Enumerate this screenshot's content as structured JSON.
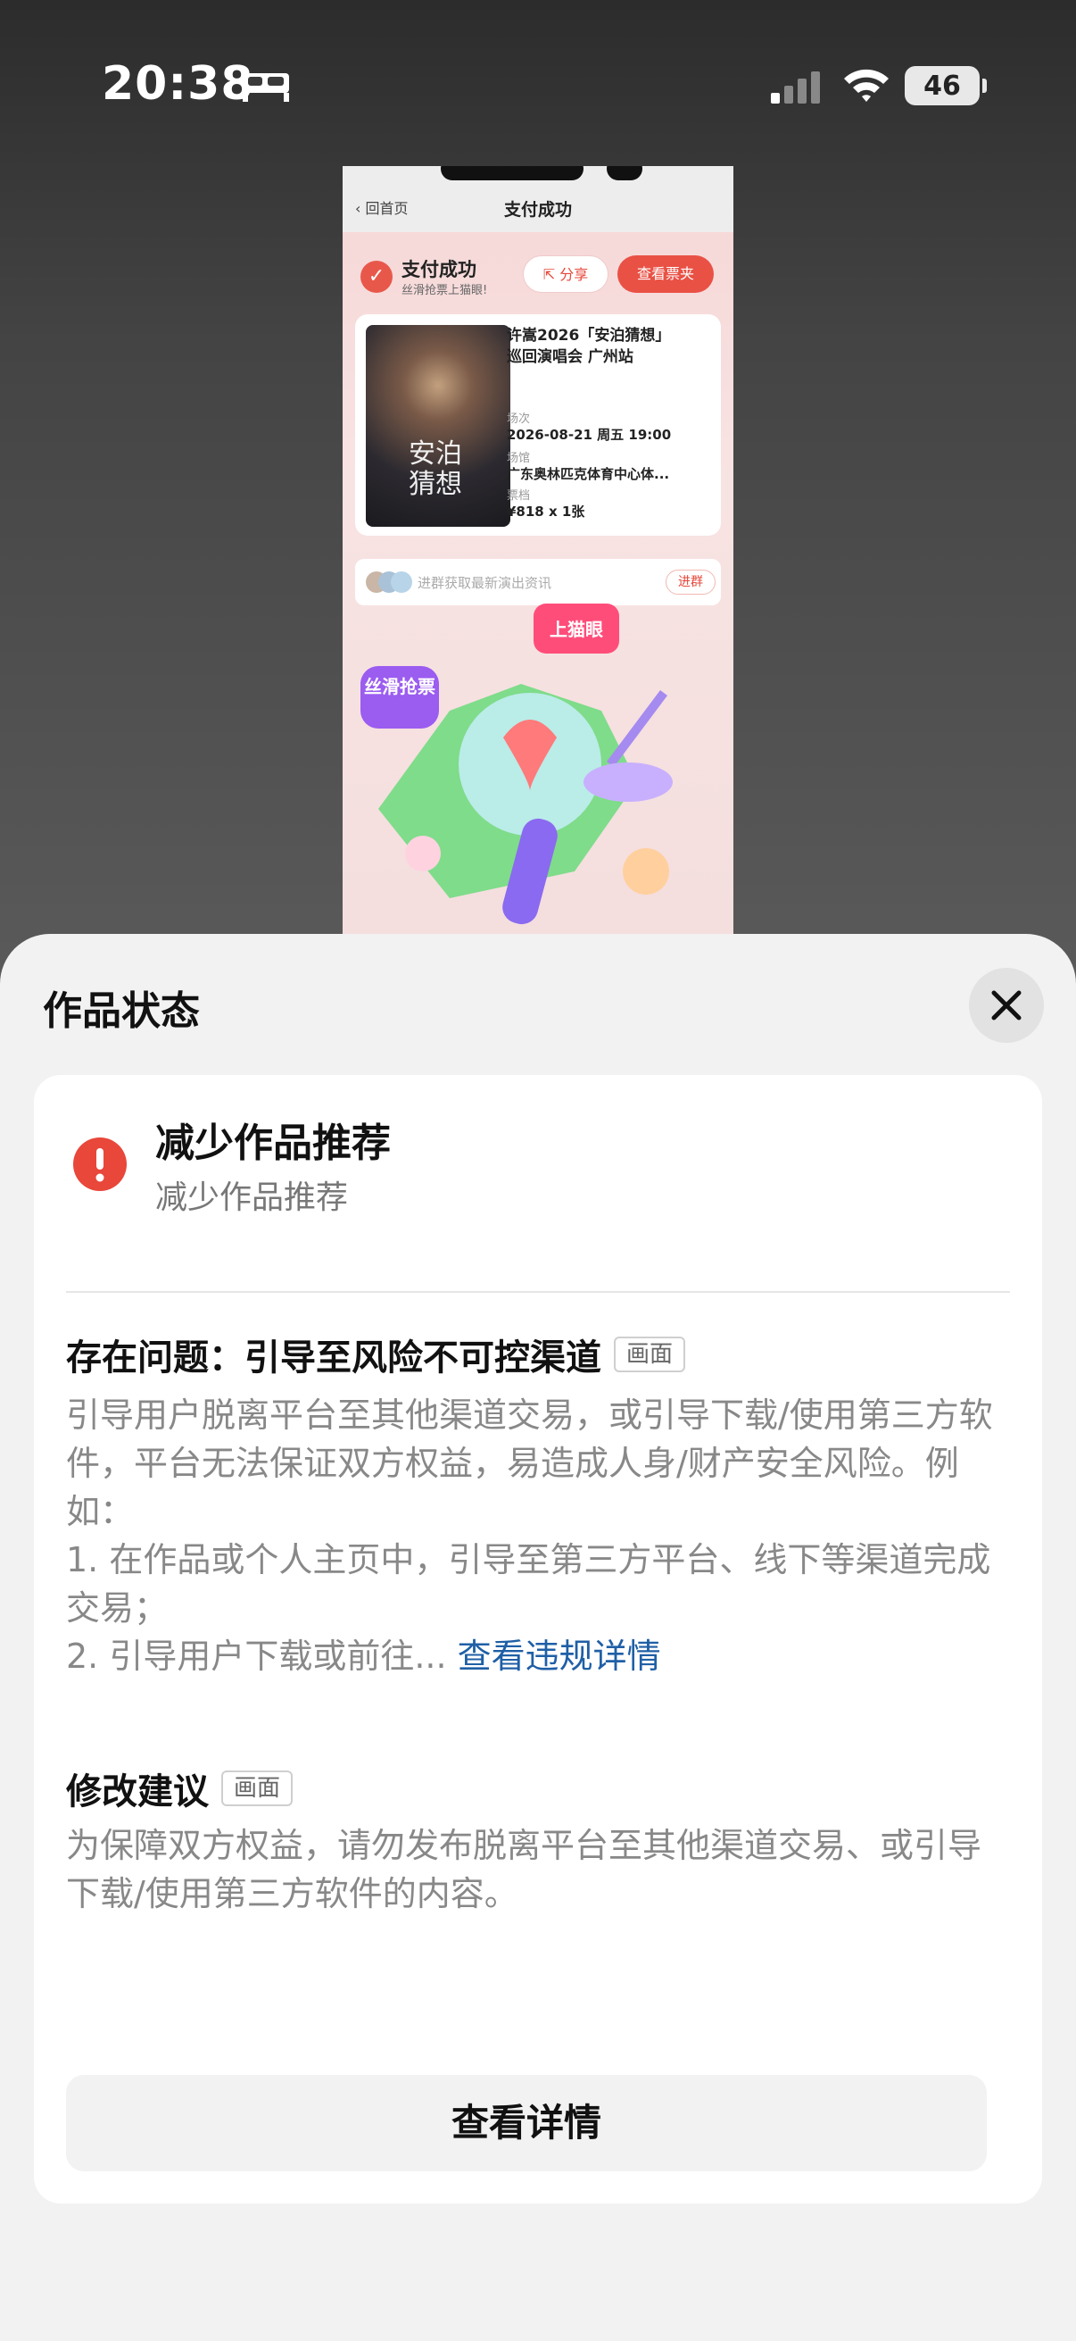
{
  "status_bar": {
    "time": "20:38",
    "battery": "46"
  },
  "preview": {
    "back_label": "回首页",
    "title": "支付成功",
    "success_title": "支付成功",
    "success_sub": "丝滑抢票上猫眼!",
    "share_label": "分享",
    "ticket_label": "查看票夹",
    "poster_text_line1": "安泊",
    "poster_text_line2": "猜想",
    "event_title": "许嵩2026「安泊猜想」巡回演唱会 广州站",
    "session_label": "场次",
    "session_value": "2026-08-21 周五 19:00",
    "venue_label": "场馆",
    "venue_value": "广东奥林匹克体育中心体...",
    "tier_label": "票档",
    "tier_value": "¥818 x 1张",
    "group_text": "进群获取最新演出资讯",
    "group_btn": "进群",
    "art_tag1": "丝滑抢票",
    "art_tag2": "上猫眼"
  },
  "sheet": {
    "title": "作品状态",
    "status_main": "减少作品推荐",
    "status_sub": "减少作品推荐",
    "issue_title": "存在问题：引导至风险不可控渠道",
    "issue_tag": "画面",
    "issue_body": "引导用户脱离平台至其他渠道交易，或引导下载/使用第三方软件，平台无法保证双方权益，易造成人身/财产安全风险。例如：",
    "issue_item1": "1. 在作品或个人主页中，引导至第三方平台、线下等渠道完成交易；",
    "issue_item2": "2. 引导用户下载或前往...",
    "issue_link": "查看违规详情",
    "suggest_title": "修改建议",
    "suggest_tag": "画面",
    "suggest_body": "为保障双方权益，请勿发布脱离平台至其他渠道交易、或引导下载/使用第三方软件的内容。",
    "detail_btn": "查看详情"
  }
}
